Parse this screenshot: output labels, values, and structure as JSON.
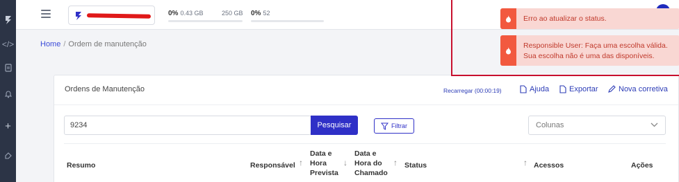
{
  "header": {
    "storage_percent": "0%",
    "storage_used": "0.43 GB",
    "storage_total": "250 GB",
    "count_percent": "0%",
    "count_value": "52"
  },
  "breadcrumb": {
    "home": "Home",
    "separator": "/",
    "current": "Ordem de manutenção"
  },
  "card": {
    "title": "Ordens de Manutenção",
    "reload": "Recarregar (00:00:19)",
    "help": "Ajuda",
    "export": "Exportar",
    "new": "Nova corretiva"
  },
  "search": {
    "value": "9234",
    "button": "Pesquisar",
    "filter": "Filtrar",
    "columns_placeholder": "Colunas"
  },
  "table": {
    "headers": {
      "resumo": "Resumo",
      "responsavel": "Responsável",
      "prevista_1": "Data e",
      "prevista_2": "Hora",
      "prevista_3": "Prevista",
      "chamado_1": "Data e",
      "chamado_2": "Hora do",
      "chamado_3": "Chamado",
      "status": "Status",
      "acessos": "Acessos",
      "acoes": "Ações"
    }
  },
  "toasts": [
    {
      "line1": "Erro ao atualizar o status."
    },
    {
      "line1": "Responsible User: Faça uma escolha válida.",
      "line2": "Sua escolha não é uma das disponíveis."
    }
  ],
  "colors": {
    "accent": "#2f30c7",
    "toast_bg": "#f9d7d3",
    "toast_icon": "#f2593f",
    "highlight_border": "#c8102e",
    "redaction": "#e01919"
  }
}
